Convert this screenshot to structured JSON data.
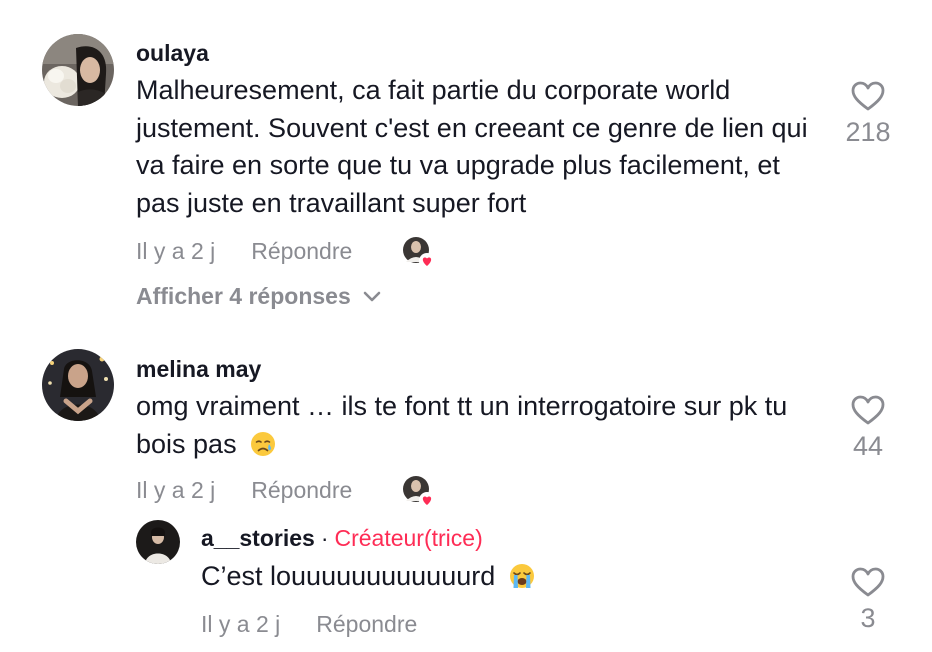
{
  "comments": [
    {
      "username": "oulaya",
      "text": "Malheuresement, ca fait partie du corporate world justement. Souvent c'est en creeant ce genre de lien qui va faire en sorte que tu va upgrade plus facilement, et pas juste en travaillant super fort",
      "date": "Il y a 2 j",
      "reply_label": "Répondre",
      "likes": "218",
      "view_replies_label": "Afficher 4 réponses"
    },
    {
      "username": "melina may",
      "text": "omg vraiment … ils te font tt un interrogatoire sur pk tu bois pas",
      "date": "Il y a 2 j",
      "reply_label": "Répondre",
      "likes": "44",
      "reply": {
        "username": "a__stories",
        "separator": "·",
        "creator_label": "Créateur(trice)",
        "text": "C’est louuuuuuuuuuuurd",
        "date": "Il y a 2 j",
        "reply_label": "Répondre",
        "likes": "3"
      }
    }
  ],
  "icons": {
    "like": "heart-outline-icon",
    "expand": "chevron-down-icon",
    "creator_liked": "creator-liked-heart-badge",
    "emoji_1": "crying-face-emoji",
    "emoji_2": "loudly-crying-face-emoji"
  },
  "colors": {
    "text": "#161823",
    "secondary": "#8a8b91",
    "creator_accent": "#fe2c55"
  }
}
